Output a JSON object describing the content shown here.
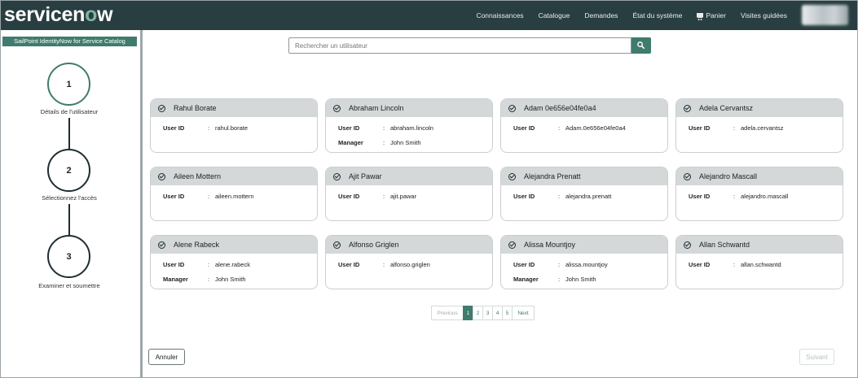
{
  "header": {
    "logo": "servicenow",
    "nav": [
      "Connaissances",
      "Catalogue",
      "Demandes",
      "État du système",
      "Panier",
      "Visites guidées"
    ]
  },
  "sidebar": {
    "catalog_tab": "SailPoint IdentityNow for Service Catalog",
    "steps": [
      {
        "number": "1",
        "label": "Détails de l'utilisateur",
        "active": true
      },
      {
        "number": "2",
        "label": "Sélectionnez l'accès",
        "active": false
      },
      {
        "number": "3",
        "label": "Examiner et soumettre",
        "active": false
      }
    ]
  },
  "search": {
    "placeholder": "Rechercher un utilisateur",
    "icon": "search-icon"
  },
  "labels": {
    "user_id": "User ID",
    "manager": "Manager",
    "colon": ":"
  },
  "users": [
    {
      "name": "Rahul Borate",
      "user_id": "rahul.borate"
    },
    {
      "name": "Abraham Lincoln",
      "user_id": "abraham.lincoln",
      "manager": "John Smith"
    },
    {
      "name": "Adam 0e656e04fe0a4",
      "user_id": "Adam.0e656e04fe0a4"
    },
    {
      "name": "Adela Cervantsz",
      "user_id": "adela.cervantsz"
    },
    {
      "name": "Aileen Mottern",
      "user_id": "aileen.mottern"
    },
    {
      "name": "Ajit Pawar",
      "user_id": "ajit.pawar"
    },
    {
      "name": "Alejandra Prenatt",
      "user_id": "alejandra.prenatt"
    },
    {
      "name": "Alejandro Mascall",
      "user_id": "alejandro.mascall"
    },
    {
      "name": "Alene Rabeck",
      "user_id": "alene.rabeck",
      "manager": "John Smith"
    },
    {
      "name": "Alfonso Griglen",
      "user_id": "alfonso.griglen"
    },
    {
      "name": "Alissa Mountjoy",
      "user_id": "alissa.mountjoy",
      "manager": "John Smith"
    },
    {
      "name": "Allan Schwantd",
      "user_id": "allan.schwantd"
    }
  ],
  "pagination": {
    "previous": "Previous",
    "pages": [
      "1",
      "2",
      "3",
      "4",
      "5"
    ],
    "current": "1",
    "next": "Next"
  },
  "footer": {
    "cancel": "Annuler",
    "next": "Suivant"
  },
  "colors": {
    "header": "#293e40",
    "accent": "#3f7c6d",
    "card_header": "#d4d8d9"
  }
}
